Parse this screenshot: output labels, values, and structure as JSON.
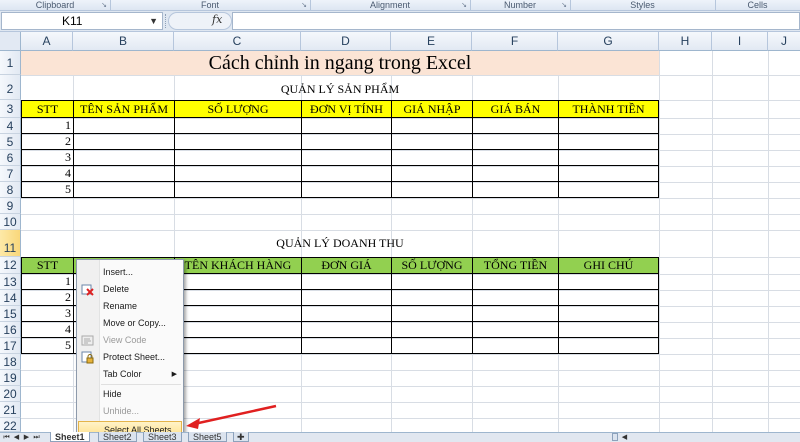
{
  "ribbon": {
    "groups": [
      "Clipboard",
      "Font",
      "Alignment",
      "Number",
      "Styles",
      "Cells"
    ]
  },
  "formula_bar": {
    "name_box": "K11",
    "fx_label": "fx",
    "content": ""
  },
  "columns": [
    "A",
    "B",
    "C",
    "D",
    "E",
    "F",
    "G",
    "H",
    "I",
    "J"
  ],
  "rows": [
    "1",
    "2",
    "3",
    "4",
    "5",
    "6",
    "7",
    "8",
    "9",
    "10",
    "11",
    "12",
    "13",
    "14",
    "15",
    "16",
    "17",
    "18",
    "19",
    "20",
    "21",
    "22"
  ],
  "sheet": {
    "title": "Cách chỉnh in ngang trong Excel",
    "table1": {
      "caption": "QUẢN LÝ SẢN PHẨM",
      "headers": [
        "STT",
        "TÊN SẢN PHẨM",
        "SỐ LƯỢNG",
        "ĐƠN VỊ TÍNH",
        "GIÁ NHẬP",
        "GIÁ BÁN",
        "THÀNH TIỀN"
      ],
      "stt": [
        "1",
        "2",
        "3",
        "4",
        "5"
      ],
      "header_color": "#ffff00"
    },
    "table2": {
      "caption": "QUẢN LÝ DOANH THU",
      "headers": [
        "STT",
        "",
        "TÊN KHÁCH HÀNG",
        "ĐƠN GIÁ",
        "SỐ LƯỢNG",
        "TỔNG TIỀN",
        "GHI CHÚ"
      ],
      "stt": [
        "1",
        "2",
        "3",
        "4",
        "5"
      ],
      "header_color": "#92d050"
    }
  },
  "context_menu": {
    "items": [
      {
        "label": "Insert...",
        "icon": "insert-icon",
        "enabled": true
      },
      {
        "label": "Delete",
        "icon": "delete-sheet-icon",
        "enabled": true
      },
      {
        "label": "Rename",
        "icon": "",
        "enabled": true
      },
      {
        "label": "Move or Copy...",
        "icon": "",
        "enabled": true
      },
      {
        "label": "View Code",
        "icon": "view-code-icon",
        "enabled": false
      },
      {
        "label": "Protect Sheet...",
        "icon": "protect-sheet-icon",
        "enabled": true
      },
      {
        "label": "Tab Color",
        "icon": "",
        "enabled": true,
        "submenu": true
      },
      {
        "label": "Hide",
        "icon": "",
        "enabled": true
      },
      {
        "label": "Unhide...",
        "icon": "",
        "enabled": false
      },
      {
        "label": "Select All Sheets",
        "icon": "",
        "enabled": true,
        "highlighted": true
      }
    ]
  },
  "sheet_tabs": [
    "Sheet1",
    "Sheet2",
    "Sheet3",
    "Sheet5"
  ],
  "active_tab": "Sheet1",
  "colors": {
    "title_fill": "#fbe4d5",
    "annotation_arrow": "#e02020",
    "menu_highlight": "#ffe08a"
  }
}
